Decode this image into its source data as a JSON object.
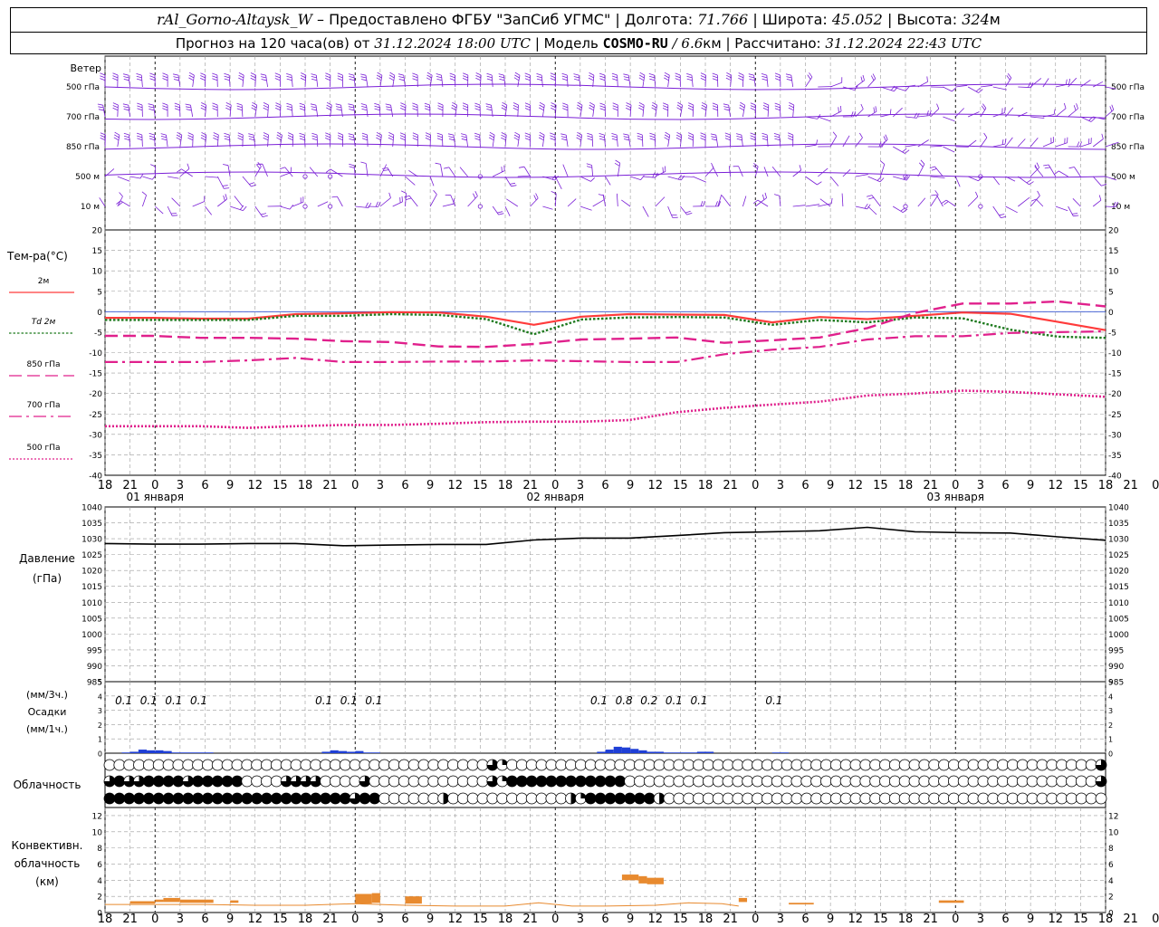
{
  "header": {
    "station": "rAl_Gorno-Altaysk_W",
    "provider": "– Предоставлено ФГБУ \"ЗапСиб УГМС\" |",
    "lon_label": "Долгота:",
    "lon_value": "71.766",
    "lat_label": "| Широта:",
    "lat_value": "45.052",
    "alt_label": "| Высота:",
    "alt_value": "324",
    "alt_unit": "м",
    "forecast_label": "Прогноз на 120 часа(ов) от",
    "forecast_start": "31.12.2024 18:00 UTC",
    "model_label": "| Модель",
    "model_name": "COSMO-RU",
    "model_res": "/ 6.6",
    "model_res_unit": "км",
    "computed_label": "| Рассчитано:",
    "computed_value": "31.12.2024 22:43 UTC"
  },
  "colors": {
    "wind": "#7a1fd6",
    "t2m": "#ff3b3b",
    "td2m": "#1f7a1f",
    "t_upper": "#e0208c",
    "pressure": "#000000",
    "precip": "#1f3fd6",
    "conv_cloud": "#e88a2f",
    "grid": "#9a9a9a",
    "zero_line": "#3050d0"
  },
  "chart_data": [
    {
      "type": "barbs",
      "panel": "wind",
      "title": "Ветер",
      "levels": [
        "500 гПа",
        "700 гПа",
        "850 гПа",
        "500 м",
        "10 м"
      ]
    },
    {
      "type": "line",
      "panel": "temperature",
      "title": "Тем-ра(°C)",
      "ylim": [
        -40,
        20
      ],
      "yticks": [
        20,
        15,
        10,
        5,
        0,
        -5,
        -10,
        -15,
        -20,
        -25,
        -30,
        -35,
        -40
      ],
      "x_hours": [
        0,
        6,
        12,
        18,
        24,
        30,
        36,
        42,
        48,
        54,
        60,
        66,
        72,
        78,
        84,
        90,
        96,
        102,
        108,
        114,
        120
      ],
      "series": [
        {
          "name": "2м",
          "key": "t2m",
          "dash": "solid",
          "values": [
            -1.5,
            -1.5,
            -1.7,
            -1.7,
            -0.6,
            -0.4,
            -0.1,
            -0.2,
            -1.2,
            -3.2,
            -1.2,
            -0.6,
            -0.7,
            -0.8,
            -2.6,
            -1.3,
            -1.8,
            -1.0,
            -0.2,
            -0.5,
            -2.5,
            -4.5
          ]
        },
        {
          "name": "Td 2м",
          "key": "td2m",
          "dash": "dots",
          "values": [
            -2.0,
            -2.0,
            -2.0,
            -2.0,
            -1.0,
            -1.0,
            -0.6,
            -0.8,
            -1.8,
            -5.5,
            -1.9,
            -1.4,
            -1.3,
            -1.4,
            -3.2,
            -2.0,
            -2.6,
            -1.4,
            -1.6,
            -4.4,
            -6.1,
            -6.4
          ]
        },
        {
          "name": "850 гПа",
          "key": "t850",
          "dash": "long",
          "values": [
            -5.9,
            -5.9,
            -6.4,
            -6.4,
            -6.6,
            -7.2,
            -7.4,
            -8.5,
            -8.6,
            -7.9,
            -6.8,
            -6.6,
            -6.3,
            -7.6,
            -7.0,
            -6.3,
            -4.0,
            -0.3,
            2.0,
            2.0,
            2.5,
            1.3
          ]
        },
        {
          "name": "700 гПа",
          "key": "t700",
          "dash": "dashdot",
          "values": [
            -12.3,
            -12.3,
            -12.3,
            -11.9,
            -11.3,
            -12.3,
            -12.3,
            -12.2,
            -12.2,
            -11.9,
            -12.1,
            -12.3,
            -12.3,
            -10.4,
            -9.3,
            -8.6,
            -6.8,
            -6.0,
            -6.0,
            -5.2,
            -5.0,
            -4.8
          ]
        },
        {
          "name": "500 гПа",
          "key": "t500",
          "dash": "dotted",
          "values": [
            -28.0,
            -28.0,
            -28.0,
            -28.4,
            -28.0,
            -27.7,
            -27.7,
            -27.4,
            -27.0,
            -26.9,
            -26.9,
            -26.5,
            -24.6,
            -23.5,
            -22.7,
            -22.0,
            -20.5,
            -20.0,
            -19.3,
            -19.6,
            -20.2,
            -20.8
          ]
        }
      ]
    },
    {
      "type": "line",
      "panel": "pressure",
      "title": "Давление",
      "unit": "(гПа)",
      "ylim": [
        985,
        1040
      ],
      "yticks": [
        1040,
        1035,
        1030,
        1025,
        1020,
        1015,
        1010,
        1005,
        1000,
        995,
        990,
        985
      ],
      "x_hours": [
        0,
        6,
        12,
        18,
        24,
        30,
        36,
        42,
        48,
        54,
        60,
        66,
        72,
        78,
        84,
        90,
        96,
        102,
        108,
        114,
        120
      ],
      "series": [
        {
          "name": "",
          "key": "pressure",
          "values": [
            1028.5,
            1028.3,
            1028.3,
            1028.5,
            1028.5,
            1027.8,
            1028.0,
            1028.2,
            1028.2,
            1029.6,
            1030.2,
            1030.2,
            1031.0,
            1031.9,
            1032.2,
            1032.5,
            1033.6,
            1032.2,
            1031.9,
            1031.8,
            1030.6,
            1029.5
          ]
        }
      ]
    },
    {
      "type": "bar",
      "panel": "precipitation",
      "title": "Осадки",
      "unit_3h": "(мм/3ч.)",
      "unit_1h": "(мм/1ч.)",
      "ylim": [
        0,
        5
      ],
      "yticks": [
        5,
        4,
        3,
        2,
        1,
        0
      ],
      "x_hours": [
        3,
        6,
        9,
        12,
        27,
        30,
        33,
        60,
        63,
        66,
        69,
        72,
        81
      ],
      "values_3h": [
        "0.1",
        "0.1",
        "0.1",
        "0.1",
        "0.1",
        "0.1",
        "0.1",
        "0.1",
        "0.8",
        "0.2",
        "0.1",
        "0.1",
        "0.1"
      ],
      "hourly_x": [
        3,
        4,
        5,
        6,
        7,
        8,
        9,
        10,
        11,
        12,
        13,
        27,
        28,
        29,
        30,
        31,
        32,
        33,
        60,
        61,
        62,
        63,
        64,
        65,
        66,
        67,
        68,
        69,
        70,
        71,
        72,
        73,
        81,
        82
      ],
      "hourly_values": [
        0.05,
        0.1,
        0.25,
        0.2,
        0.2,
        0.15,
        0.05,
        0.05,
        0.05,
        0.05,
        0.05,
        0.1,
        0.2,
        0.15,
        0.1,
        0.15,
        0.05,
        0.05,
        0.1,
        0.25,
        0.45,
        0.4,
        0.3,
        0.2,
        0.1,
        0.1,
        0.05,
        0.05,
        0.05,
        0.05,
        0.1,
        0.1,
        0.05,
        0.05
      ]
    },
    {
      "type": "table",
      "panel": "clouds",
      "title": "Облачность",
      "encoding": "0=clear 1=quarter 2=half 3=three-quarters 4=overcast",
      "rows": [
        "000000000000000000000000000000000000000310000000000000000000000000000000000000000000000000000000000003",
        "343344443444440000333300003000000000000314444444444440000000000000000000000000000000000000000000000003",
        "444444444444444444444444434400000020000000000002144444442000000000000000000000000000000000000000000000"
      ]
    },
    {
      "type": "bar",
      "panel": "convective",
      "title": "Конвективн.",
      "subtitle": "облачность",
      "unit": "(км)",
      "ylim": [
        0,
        13
      ],
      "yticks": [
        12,
        10,
        8,
        6,
        4,
        2,
        0
      ],
      "segments": [
        {
          "start": 3,
          "end": 6,
          "base": 1.1,
          "top": 1.4
        },
        {
          "start": 6,
          "end": 7,
          "base": 1.3,
          "top": 1.6
        },
        {
          "start": 7,
          "end": 9,
          "base": 1.3,
          "top": 1.8
        },
        {
          "start": 9,
          "end": 13,
          "base": 1.2,
          "top": 1.6
        },
        {
          "start": 15,
          "end": 16,
          "base": 1.2,
          "top": 1.5
        },
        {
          "start": 30,
          "end": 32,
          "base": 1.1,
          "top": 2.3
        },
        {
          "start": 32,
          "end": 33,
          "base": 1.2,
          "top": 2.4
        },
        {
          "start": 36,
          "end": 38,
          "base": 1.1,
          "top": 2.0
        },
        {
          "start": 62,
          "end": 64,
          "base": 4.0,
          "top": 4.7
        },
        {
          "start": 64,
          "end": 65,
          "base": 3.6,
          "top": 4.5
        },
        {
          "start": 65,
          "end": 67,
          "base": 3.5,
          "top": 4.3
        },
        {
          "start": 76,
          "end": 77,
          "base": 1.3,
          "top": 1.8
        },
        {
          "start": 82,
          "end": 85,
          "base": 1.0,
          "top": 1.2
        },
        {
          "start": 100,
          "end": 103,
          "base": 1.2,
          "top": 1.5
        }
      ],
      "line_x": [
        0,
        6,
        12,
        18,
        24,
        30,
        36,
        42,
        48,
        52,
        56,
        60,
        66,
        70,
        74,
        76
      ],
      "line_values": [
        1.0,
        1.0,
        1.0,
        0.9,
        0.9,
        1.1,
        0.9,
        0.8,
        0.8,
        1.2,
        0.8,
        0.8,
        0.9,
        1.2,
        1.1,
        0.8
      ]
    }
  ],
  "axis": {
    "hour_ticks": [
      "18",
      "21",
      "0",
      "3",
      "6",
      "9",
      "12",
      "15",
      "18",
      "21",
      "0",
      "3",
      "6",
      "9",
      "12",
      "15",
      "18",
      "21",
      "0",
      "3",
      "6",
      "9",
      "12",
      "15",
      "18",
      "21",
      "0",
      "3",
      "6",
      "9",
      "12",
      "15",
      "18",
      "21",
      "0",
      "3",
      "6",
      "9",
      "12",
      "15",
      "18",
      "21",
      "0"
    ],
    "day_labels": [
      "01 января",
      "02 января",
      "03 января"
    ],
    "day_start_hours": [
      6,
      54,
      102
    ]
  }
}
